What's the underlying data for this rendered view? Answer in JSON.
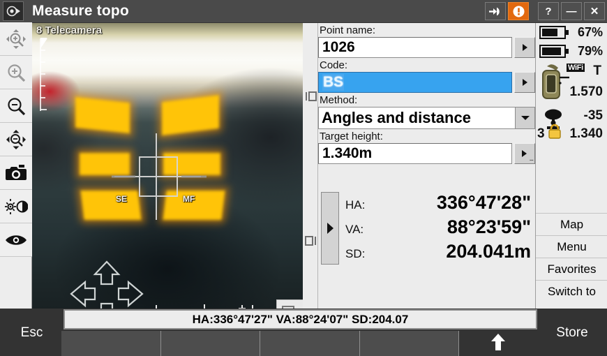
{
  "titlebar": {
    "app_icon": "survey-instrument-icon",
    "title": "Measure topo",
    "buttons": [
      {
        "name": "connect-icon",
        "glyph": "→◖",
        "label": ""
      },
      {
        "name": "alert-icon",
        "glyph": "❗",
        "label": ""
      },
      {
        "name": "help-button",
        "glyph": "?",
        "label": "?"
      },
      {
        "name": "minimize-button",
        "glyph": "—",
        "label": "—"
      },
      {
        "name": "close-button",
        "glyph": "✕",
        "label": "✕"
      }
    ]
  },
  "left_toolbar": {
    "items": [
      {
        "name": "zoom-pan-in-icon",
        "label": "Zoom in and pan"
      },
      {
        "name": "zoom-in-icon",
        "label": "Zoom in"
      },
      {
        "name": "zoom-out-icon",
        "label": "Zoom out"
      },
      {
        "name": "zoom-pan-out-icon",
        "label": "Zoom out and pan"
      },
      {
        "name": "camera-icon",
        "label": "Snapshot"
      },
      {
        "name": "brightness-contrast-icon",
        "label": "Brightness / contrast"
      },
      {
        "name": "eye-icon",
        "label": "View"
      }
    ]
  },
  "camera": {
    "label": "8 Telecamera",
    "crosshair_labels": {
      "left": "SE",
      "right": "MF"
    },
    "bottom_icons": [
      {
        "name": "target-decrease-icon",
        "glyph": "-"
      },
      {
        "name": "target-center-icon",
        "glyph": ""
      },
      {
        "name": "target-increase-icon",
        "glyph": "+"
      },
      {
        "name": "picture-in-picture-icon",
        "glyph": ""
      }
    ],
    "navpad": {
      "up": "nav-up-arrow-icon",
      "down": "nav-down-arrow-icon",
      "left": "nav-left-arrow-icon",
      "right": "nav-right-arrow-icon"
    }
  },
  "strip_icons": [
    {
      "name": "video-window-left-icon"
    },
    {
      "name": "video-window-right-icon"
    }
  ],
  "form": {
    "point_name": {
      "label": "Point name:",
      "value": "1026",
      "button": "dropdown-arrow-icon"
    },
    "code": {
      "label": "Code:",
      "value": "BS",
      "selected": true,
      "button": "dropdown-arrow-icon"
    },
    "method": {
      "label": "Method:",
      "value": "Angles and distance",
      "button": "dropdown-arrow-icon"
    },
    "target_height": {
      "label": "Target height:",
      "value": "1.340m",
      "button": "options-arrow-icon"
    }
  },
  "measurements": {
    "handle_icon": "expand-arrow-icon",
    "rows": [
      {
        "key": "HA:",
        "value": "336°47'28\""
      },
      {
        "key": "VA:",
        "value": "88°23'59\""
      },
      {
        "key": "SD:",
        "value": "204.041m"
      }
    ]
  },
  "status_panel": {
    "battery_1": {
      "icon": "battery-icon",
      "percent": "67%"
    },
    "battery_2": {
      "icon": "battery-icon",
      "percent": "79%"
    },
    "instrument": {
      "icon": "total-station-icon",
      "wifi_badge": "WiFi",
      "target_letter": "T",
      "value": "1.570"
    },
    "prism": {
      "icon": "prism-target-icon",
      "lock_icon": "lock-icon",
      "count": "3",
      "signal": "-35",
      "value": "1.340"
    },
    "buttons": [
      {
        "name": "map-button",
        "label": "Map",
        "accel": "M"
      },
      {
        "name": "menu-button",
        "label": "Menu",
        "accel": "e"
      },
      {
        "name": "favorites-button",
        "label": "Favorites",
        "accel": "a"
      },
      {
        "name": "switch-to-button",
        "label": "Switch to",
        "accel": "w"
      }
    ]
  },
  "bottom": {
    "esc_label": "Esc",
    "store_label": "Store",
    "status_text": "HA:336°47'27\"  VA:88°24'07\"  SD:204.07",
    "fkeys": [
      {
        "name": "fkey-1",
        "label": ""
      },
      {
        "name": "fkey-2",
        "label": ""
      },
      {
        "name": "fkey-3",
        "label": ""
      },
      {
        "name": "fkey-4",
        "label": ""
      },
      {
        "name": "fkey-shift",
        "label": "",
        "icon": "up-arrow-icon"
      }
    ]
  },
  "colors": {
    "titlebar": "#4a4a4a",
    "alert": "#e2690f",
    "selection": "#37a3ef",
    "panel": "#ececec",
    "dark_chrome": "#333333"
  }
}
